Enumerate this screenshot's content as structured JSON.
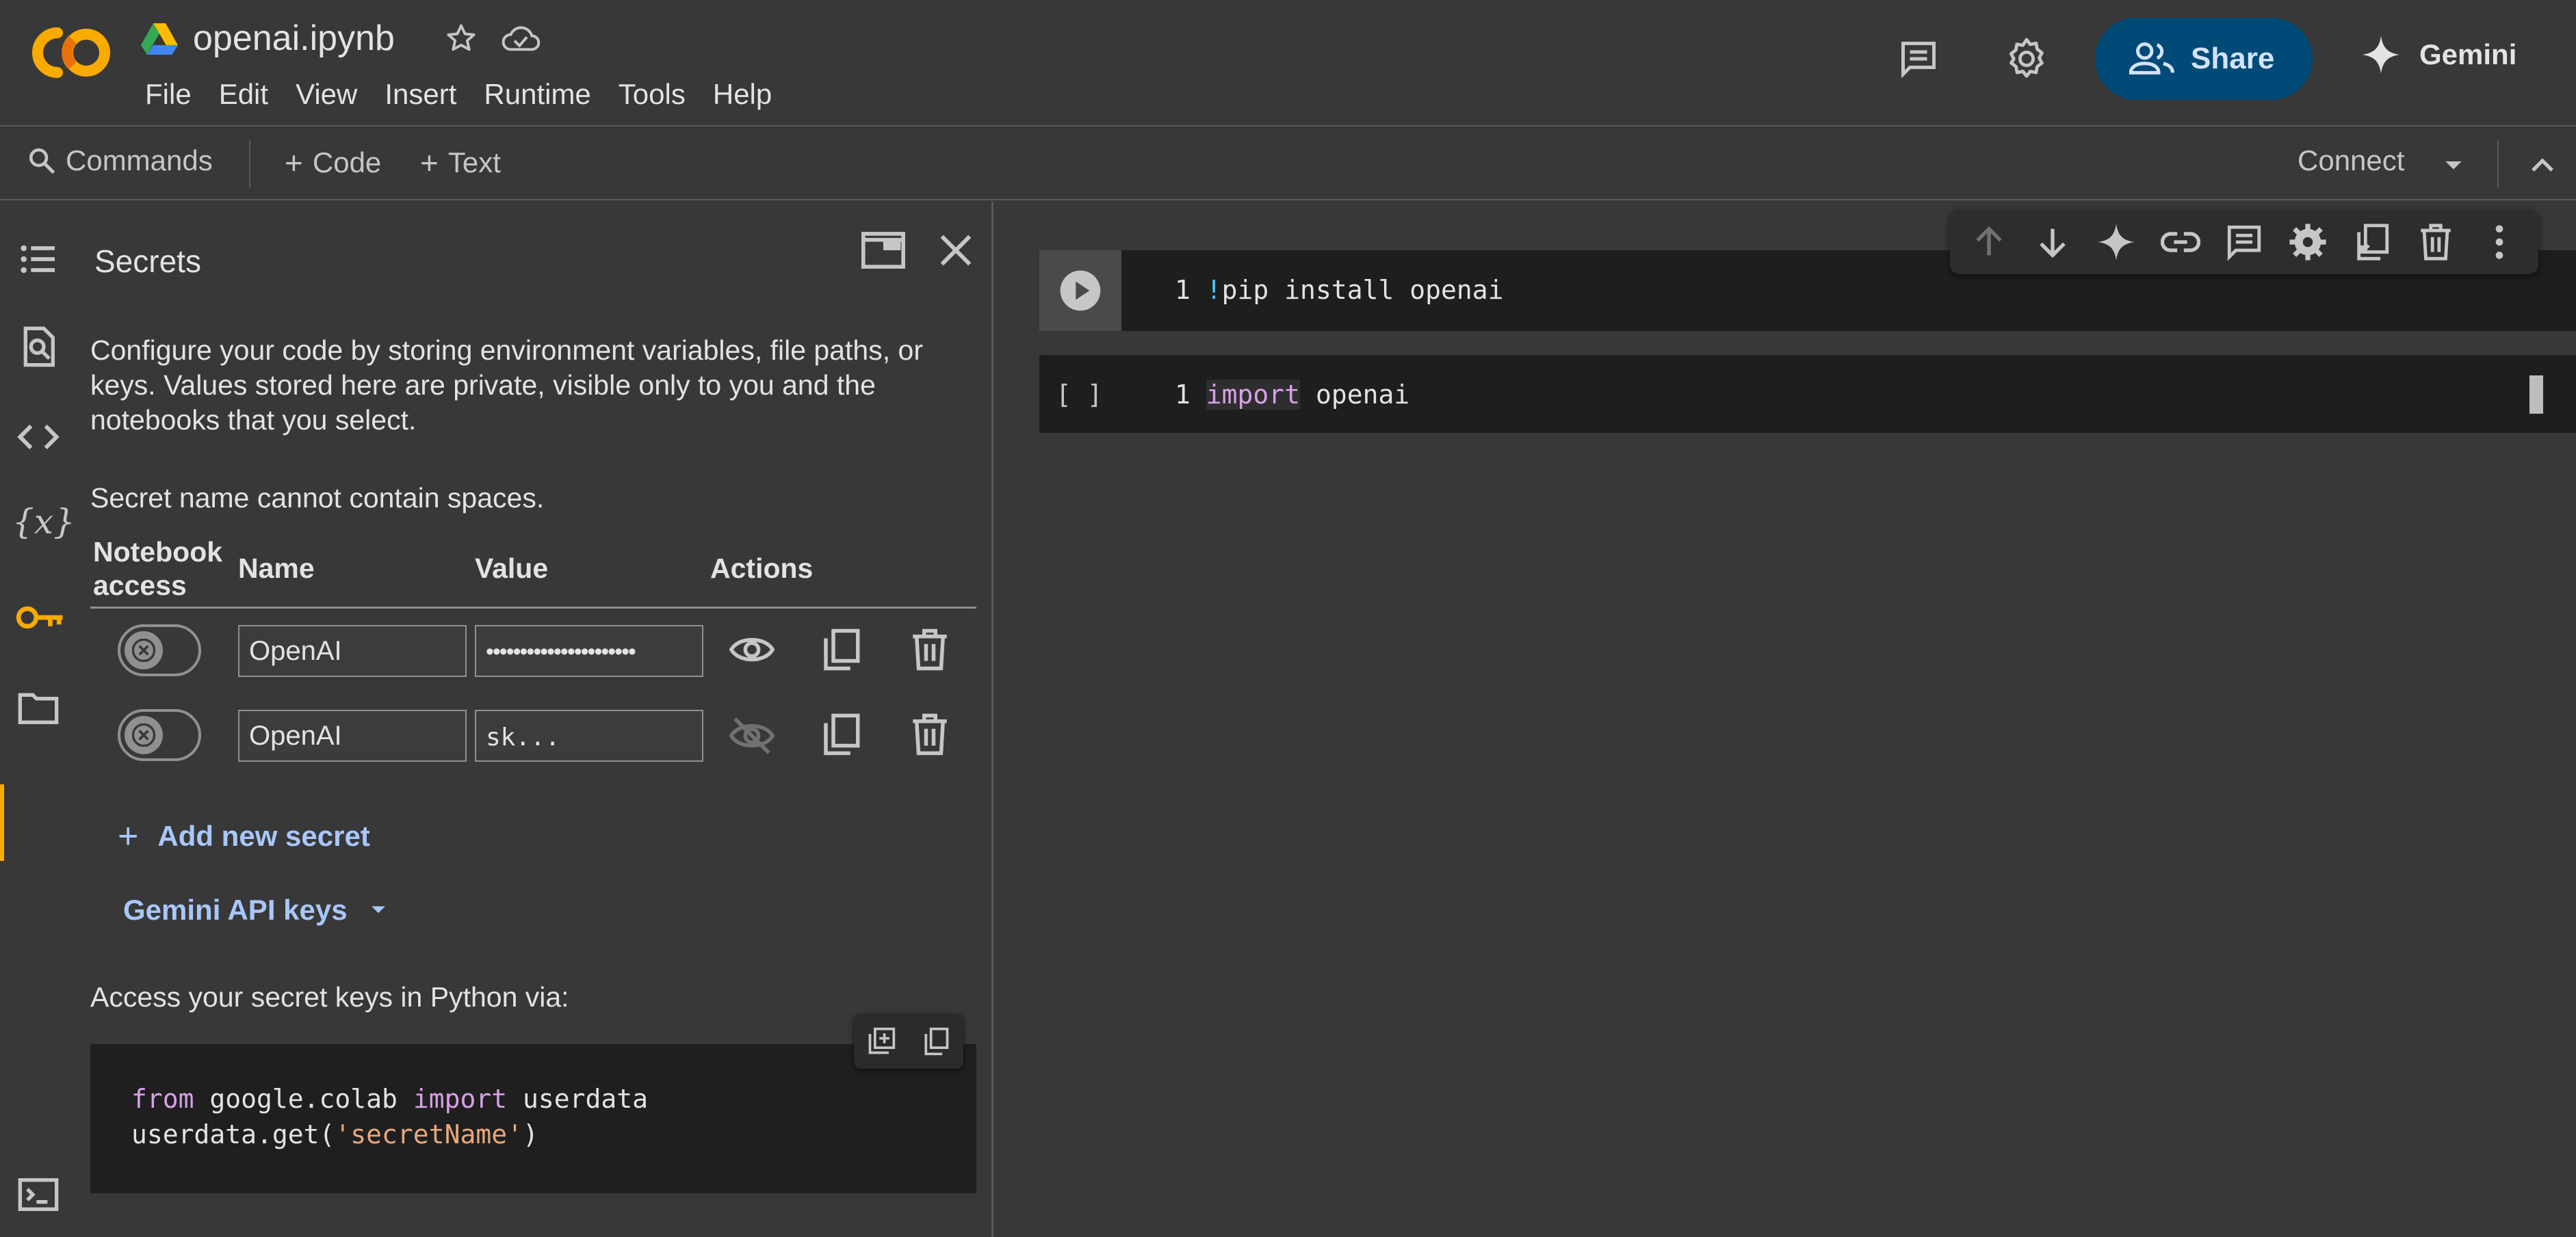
{
  "header": {
    "notebook_title": "openai.ipynb",
    "menu": [
      "File",
      "Edit",
      "View",
      "Insert",
      "Runtime",
      "Tools",
      "Help"
    ],
    "share_label": "Share",
    "gemini_label": "Gemini"
  },
  "toolbar": {
    "commands_label": "Commands",
    "add_code_label": "Code",
    "add_text_label": "Text",
    "connect_label": "Connect"
  },
  "panel": {
    "title": "Secrets",
    "description": "Configure your code by storing environment variables, file paths, or keys. Values stored here are private, visible only to you and the notebooks that you select.",
    "rule": "Secret name cannot contain spaces.",
    "columns": {
      "access_line1": "Notebook",
      "access_line2": "access",
      "name": "Name",
      "value": "Value",
      "actions": "Actions"
    },
    "secrets": [
      {
        "name": "OpenAI",
        "value": "••••••••••••••••••••••",
        "visible": false,
        "access": false
      },
      {
        "name": "OpenAI",
        "value": "sk...",
        "visible": true,
        "access": false
      }
    ],
    "add_secret_label": "Add new secret",
    "gemini_keys_label": "Gemini API keys",
    "access_text": "Access your secret keys in Python via:",
    "code": {
      "line1_kw1": "from",
      "line1_mod": " google.colab ",
      "line1_kw2": "import",
      "line1_name": " userdata",
      "line2_pre": "userdata.get(",
      "line2_str": "'secretName'",
      "line2_post": ")"
    }
  },
  "cells": [
    {
      "line_no": "1",
      "bang": "!",
      "code": "pip install openai"
    },
    {
      "run_label": "[ ]",
      "line_no": "1",
      "keyword": "import",
      "code": " openai"
    }
  ],
  "colors": {
    "accent_key": "#f9ab00",
    "share_bg": "#004a77",
    "link": "#a8c7fa"
  }
}
